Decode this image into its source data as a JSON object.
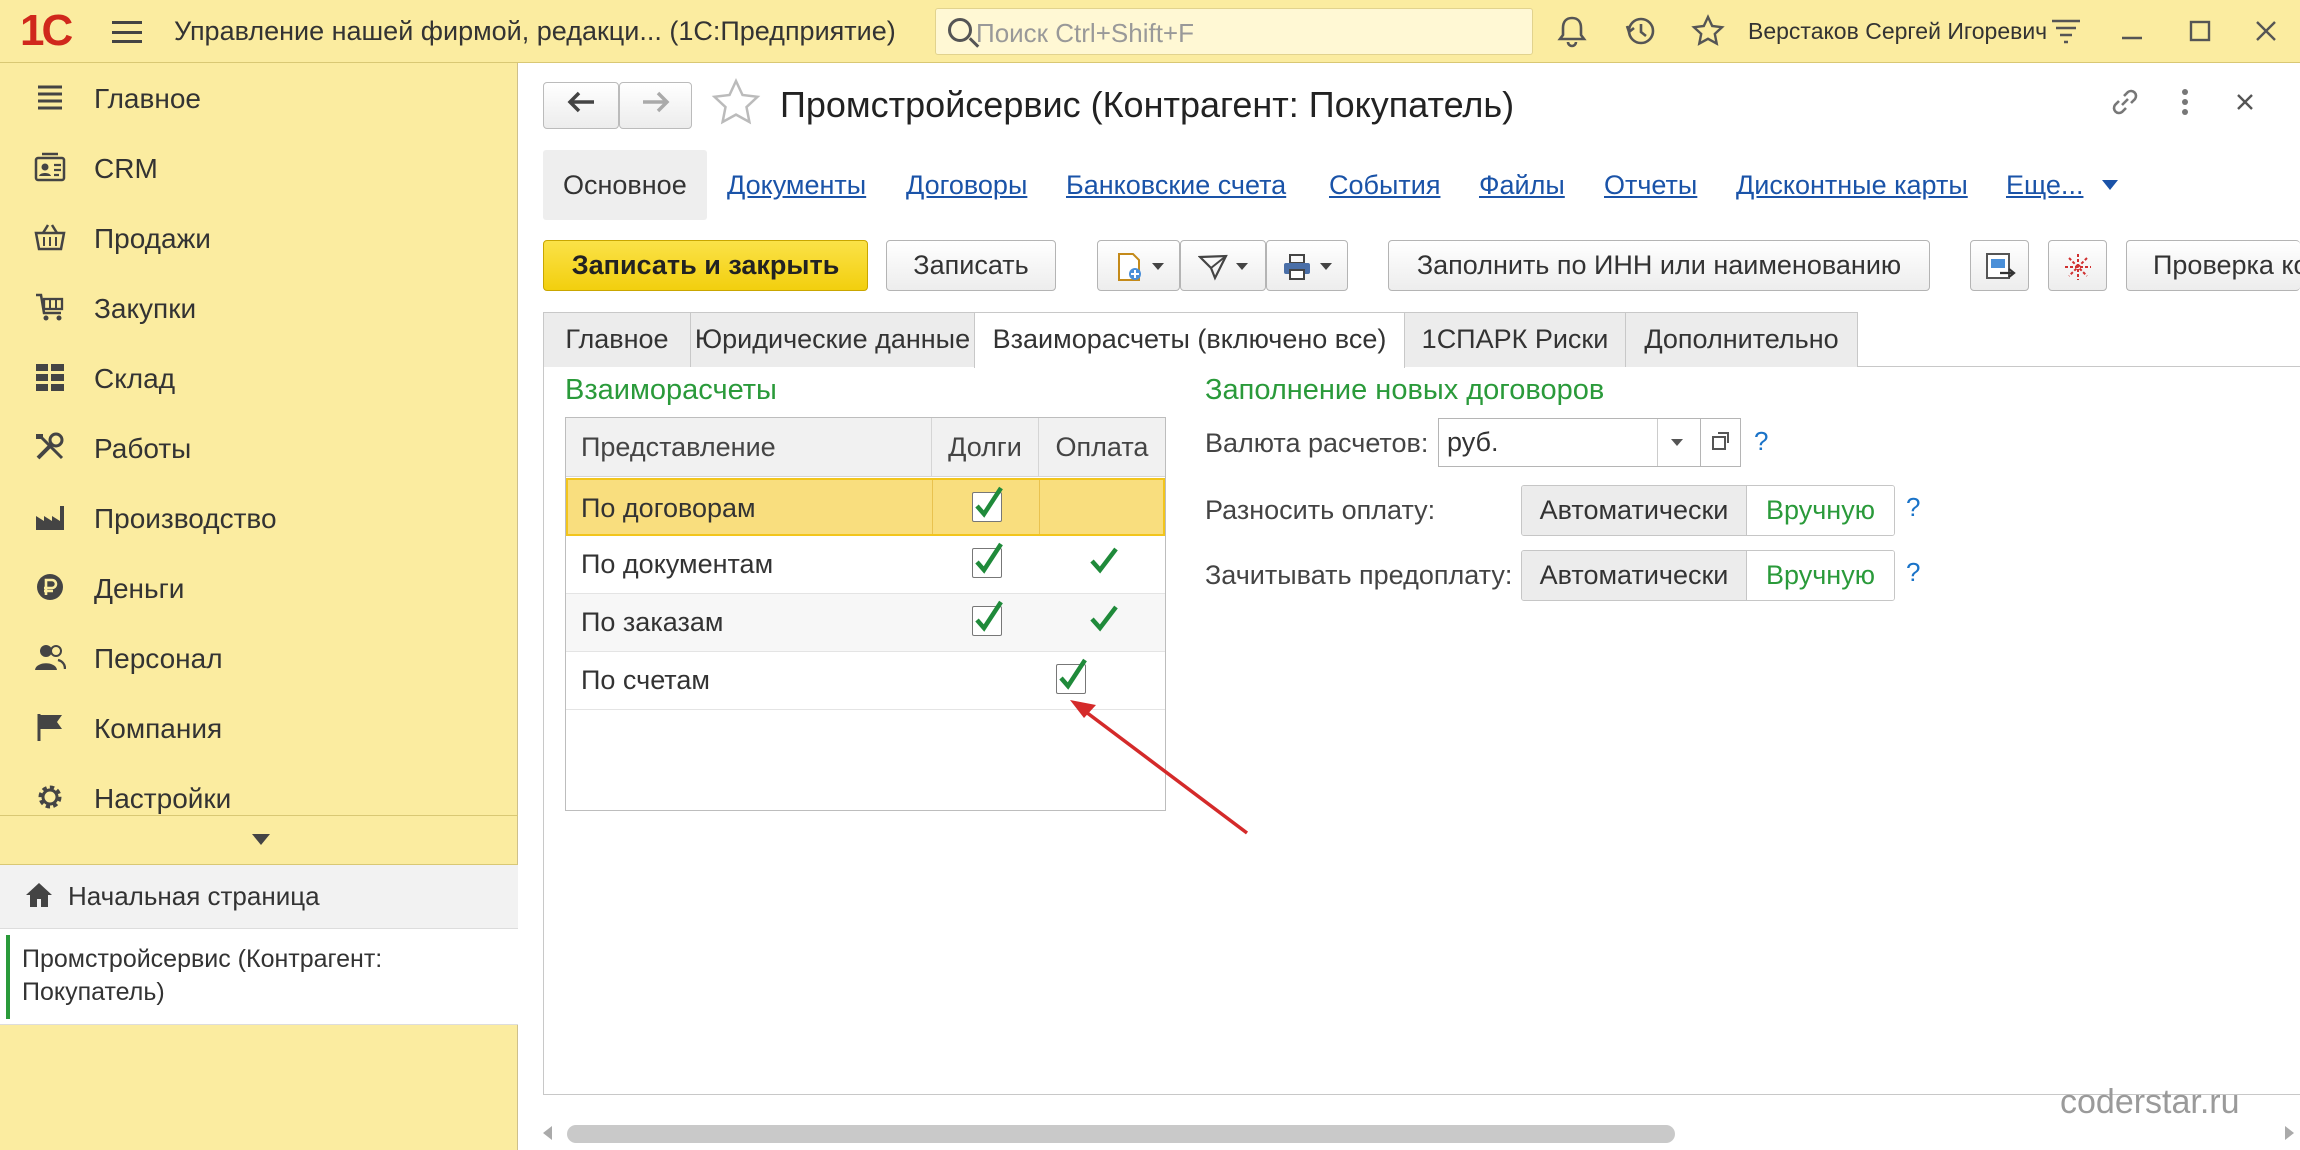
{
  "app": {
    "logo": "1С",
    "title": "Управление нашей фирмой, редакци...  (1С:Предприятие)",
    "search_placeholder": "Поиск Ctrl+Shift+F",
    "user": "Верстаков Сергей Игоревич",
    "icons": [
      "bell-icon",
      "history-icon",
      "star-icon",
      "settings-lines-icon",
      "minimize-icon",
      "maximize-icon",
      "close-icon"
    ]
  },
  "sidebar": {
    "items": [
      {
        "label": "Главное",
        "icon": "hamburger-icon"
      },
      {
        "label": "CRM",
        "icon": "contact-card-icon"
      },
      {
        "label": "Продажи",
        "icon": "basket-icon"
      },
      {
        "label": "Закупки",
        "icon": "cart-icon"
      },
      {
        "label": "Склад",
        "icon": "warehouse-grid-icon"
      },
      {
        "label": "Работы",
        "icon": "tools-icon"
      },
      {
        "label": "Производство",
        "icon": "factory-icon"
      },
      {
        "label": "Деньги",
        "icon": "ruble-icon"
      },
      {
        "label": "Персонал",
        "icon": "people-icon"
      },
      {
        "label": "Компания",
        "icon": "flag-icon"
      },
      {
        "label": "Настройки",
        "icon": "gear-icon"
      }
    ],
    "home": "Начальная страница",
    "open_window": "Промстройсервис (Контрагент: Покупатель)"
  },
  "form": {
    "title": "Промстройсервис (Контрагент: Покупатель)",
    "link_tabs": [
      "Основное",
      "Документы",
      "Договоры",
      "Банковские счета",
      "События",
      "Файлы",
      "Отчеты",
      "Дисконтные карты",
      "Еще..."
    ],
    "buttons": {
      "save_close": "Записать и закрыть",
      "save": "Записать",
      "fill_inn": "Заполнить по ИНН или наименованию",
      "check": "Проверка ко"
    },
    "tabs": [
      "Главное",
      "Юридические данные",
      "Взаиморасчеты (включено все)",
      "1СПАРК Риски",
      "Дополнительно"
    ],
    "active_tab": 2
  },
  "settlements": {
    "header": "Взаиморасчеты",
    "columns": [
      "Представление",
      "Долги",
      "Оплата"
    ],
    "rows": [
      {
        "name": "По договорам",
        "debts": true,
        "payment": false,
        "selected": true
      },
      {
        "name": "По документам",
        "debts": true,
        "payment": true
      },
      {
        "name": "По заказам",
        "debts": true,
        "payment": true
      },
      {
        "name": "По счетам",
        "debts": false,
        "payment": true
      }
    ]
  },
  "new_contracts": {
    "header": "Заполнение новых договоров",
    "currency_label": "Валюта расчетов:",
    "currency_value": "руб.",
    "distribute_label": "Разносить оплату:",
    "offset_label": "Зачитывать предоплату:",
    "auto": "Автоматически",
    "manual": "Вручную",
    "help": "?"
  },
  "watermark": "coderstar.ru",
  "colors": {
    "titlebar": "#fbeca0",
    "accent_green": "#2a9a3a",
    "link_blue": "#1a53a8",
    "primary_button": "#f2cf0e",
    "arrow_red": "#d42a2a"
  }
}
